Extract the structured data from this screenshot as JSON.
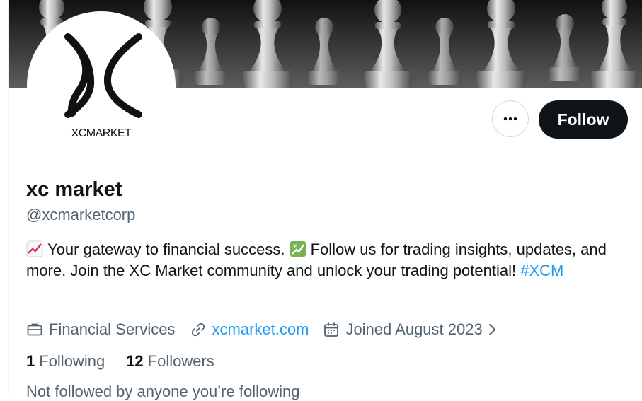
{
  "profile": {
    "avatar_logo_text": "XCMARKET",
    "name": "xc market",
    "handle": "@xcmarketcorp",
    "bio_part1": "Your gateway to financial success.",
    "bio_part2": "Follow us for trading insights, updates, and more. Join the XC Market community and unlock your trading potential!",
    "hashtag": "#XCM",
    "category": "Financial Services",
    "website": "xcmarket.com",
    "joined": "Joined August 2023",
    "following_count": "1",
    "following_label": "Following",
    "followers_count": "12",
    "followers_label": "Followers",
    "followed_by_note": "Not followed by anyone you’re following"
  },
  "actions": {
    "follow_label": "Follow",
    "more_icon": "more-horizontal-icon"
  },
  "colors": {
    "accent": "#1d9bf0",
    "text": "#0f1419",
    "secondary": "#536471",
    "button_dark": "#0f1419"
  }
}
